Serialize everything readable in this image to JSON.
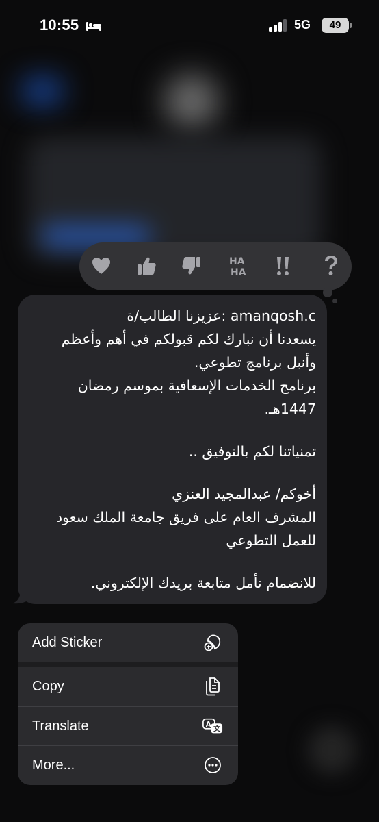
{
  "status_bar": {
    "time": "10:55",
    "network": "5G",
    "battery": "49"
  },
  "tapbacks": [
    {
      "name": "heart-icon"
    },
    {
      "name": "thumbs-up-icon"
    },
    {
      "name": "thumbs-down-icon"
    },
    {
      "name": "haha-icon",
      "text": "HA HA"
    },
    {
      "name": "emphasis-icon",
      "text": "!!"
    },
    {
      "name": "question-icon",
      "text": "?"
    }
  ],
  "message": {
    "lines": [
      "amanqosh.c :عزيزنا الطالب/ة",
      "يسعدنا أن نبارك لكم قبولكم في أهم وأعظم",
      "وأنبل برنامج تطوعي.",
      "برنامج الخدمات الإسعافية بموسم رمضان",
      "1447هـ.",
      "",
      "تمنياتنا لكم بالتوفيق ..",
      "",
      "أخوكم/ عبدالمجيد العنزي",
      "المشرف العام على فريق جامعة الملك سعود",
      "للعمل التطوعي",
      "",
      "للانضمام نأمل متابعة بريدك الإلكتروني."
    ]
  },
  "menu": {
    "add_sticker": "Add Sticker",
    "copy": "Copy",
    "translate": "Translate",
    "more": "More..."
  },
  "colors": {
    "bubble": "#26262a",
    "menu": "#2b2b2e",
    "tapback_bar": "#333336",
    "tapback_icon": "#a5a5aa"
  }
}
